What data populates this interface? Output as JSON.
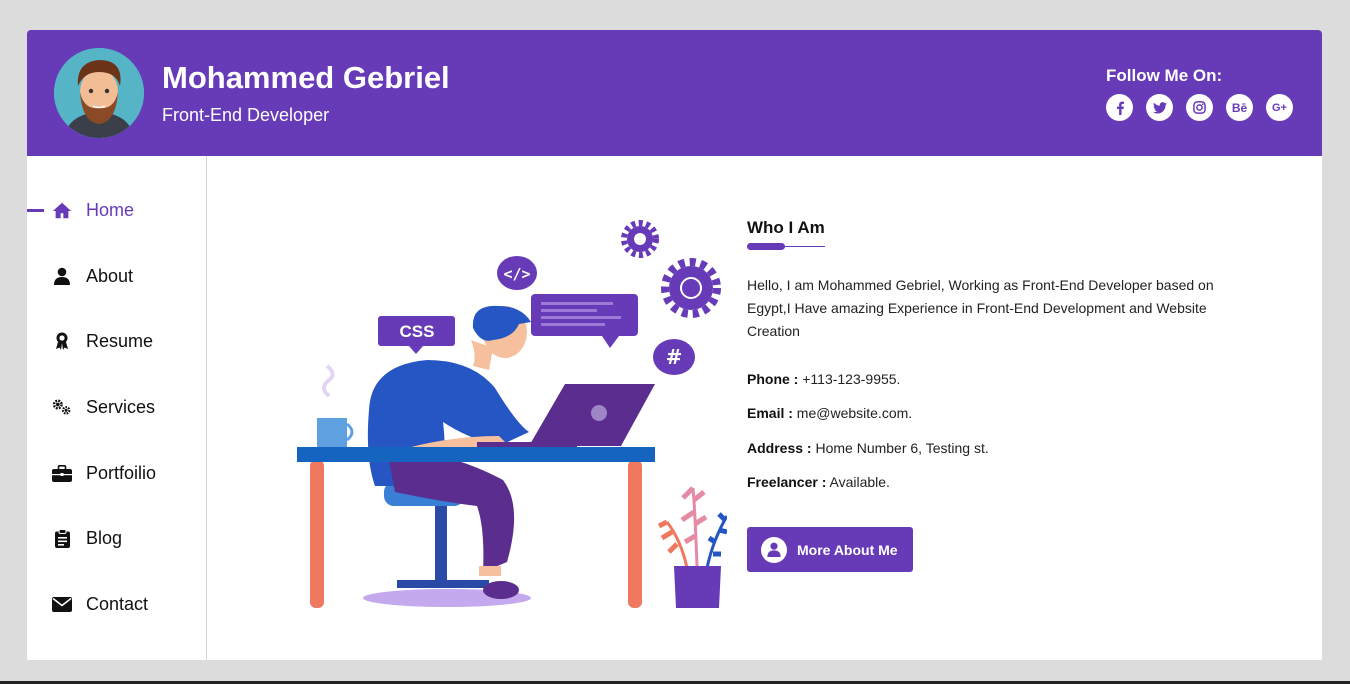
{
  "profile": {
    "name": "Mohammed Gebriel",
    "role": "Front-End Developer"
  },
  "follow": {
    "title": "Follow Me On:",
    "icons": [
      "facebook-icon",
      "twitter-icon",
      "instagram-icon",
      "behance-icon",
      "google-plus-icon"
    ],
    "labels": [
      "f",
      "t",
      "i",
      "Bē",
      "G+"
    ]
  },
  "nav": {
    "items": [
      {
        "label": "Home",
        "icon": "home-icon",
        "active": true
      },
      {
        "label": "About",
        "icon": "user-icon"
      },
      {
        "label": "Resume",
        "icon": "award-icon"
      },
      {
        "label": "Services",
        "icon": "gears-icon"
      },
      {
        "label": "Portfoilio",
        "icon": "briefcase-icon"
      },
      {
        "label": "Blog",
        "icon": "clipboard-icon"
      },
      {
        "label": "Contact",
        "icon": "envelope-icon"
      }
    ]
  },
  "illustration": {
    "css_label": "CSS",
    "code_label": "</>",
    "hash_label": "#"
  },
  "about": {
    "title": "Who I Am",
    "bio": "Hello, I am Mohammed Gebriel, Working as Front-End Developer based on Egypt,I Have amazing Experience in Front-End Development and Website Creation",
    "phone_label": "Phone :",
    "phone": "+113-123-9955.",
    "email_label": "Email :",
    "email": "me@website.com.",
    "address_label": "Address :",
    "address": "Home Number 6, Testing st.",
    "freelancer_label": "Freelancer :",
    "freelancer": "Available.",
    "button_label": "More About Me"
  },
  "colors": {
    "accent": "#673ab7",
    "background": "#dcdcdc"
  }
}
